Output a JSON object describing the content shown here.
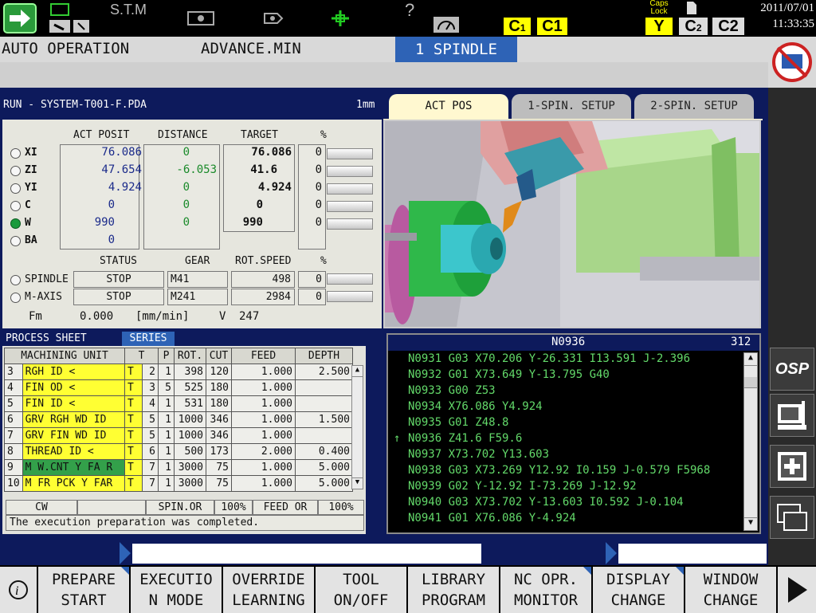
{
  "topbar": {
    "stm": "S.T.M",
    "help": "?",
    "badges": {
      "c1a": "C",
      "c1a_sub": "1",
      "c1": "C1",
      "y": "Y",
      "c2a": "C",
      "c2a_sub": "2",
      "c2": "C2"
    },
    "caps_lock": "Caps Lock",
    "date": "2011/07/01",
    "time": "11:33:35",
    "icons": [
      "mode-arrow-icon",
      "tool-icon",
      "screen-icon",
      "camera-icon",
      "sensor-icon",
      "crosshair-icon",
      "gauge-icon",
      "page-icon"
    ]
  },
  "title": {
    "mode": "AUTO OPERATION",
    "sub": "ADVANCE.MIN",
    "spindle": "1 SPINDLE"
  },
  "run": {
    "label": "RUN - SYSTEM-T001-F.PDA",
    "unit": "1mm"
  },
  "tabs": [
    "ACT POS",
    "1-SPIN. SETUP",
    "2-SPIN. SETUP"
  ],
  "position": {
    "headers": {
      "act": "ACT POSIT",
      "dist": "DISTANCE",
      "target": "TARGET",
      "pct": "%"
    },
    "axes": [
      {
        "name": "XI",
        "act": "76.086",
        "dist": "0",
        "target": "76.086",
        "pct": "0",
        "selected": false
      },
      {
        "name": "ZI",
        "act": "47.654",
        "dist": "-6.053",
        "target": "41.6",
        "pct": "0",
        "selected": false
      },
      {
        "name": "YI",
        "act": "4.924",
        "dist": "0",
        "target": "4.924",
        "pct": "0",
        "selected": false
      },
      {
        "name": "C",
        "act": "0",
        "dist": "0",
        "target": "0",
        "pct": "0",
        "selected": false
      },
      {
        "name": "W",
        "act": "990",
        "dist": "0",
        "target": "990",
        "pct": "0",
        "selected": true
      },
      {
        "name": "BA",
        "act": "0",
        "dist": "",
        "target": "",
        "pct": "",
        "selected": false
      }
    ],
    "spindle_headers": {
      "status": "STATUS",
      "gear": "GEAR",
      "speed": "ROT.SPEED",
      "pct": "%"
    },
    "spindles": [
      {
        "name": "SPINDLE",
        "status": "STOP",
        "gear": "M41",
        "speed": "498",
        "pct": "0"
      },
      {
        "name": "M-AXIS",
        "status": "STOP",
        "gear": "M241",
        "speed": "2984",
        "pct": "0"
      }
    ],
    "fm_label": "Fm",
    "fm_value": "0.000",
    "fm_unit": "[mm/min]",
    "v_label": "V",
    "v_value": "247"
  },
  "process": {
    "title": "PROCESS SHEET",
    "series": "SERIES",
    "columns": [
      "MACHINING UNIT",
      "T",
      "P",
      "ROT.",
      "CUT",
      "FEED",
      "DEPTH"
    ],
    "rows": [
      {
        "no": "3",
        "unit": "RGH ID <",
        "t": "T",
        "tn": "2",
        "p": "1",
        "rot": "398",
        "cut": "120",
        "feed": "1.000",
        "depth": "2.500",
        "color": "y"
      },
      {
        "no": "4",
        "unit": "FIN OD <",
        "t": "T",
        "tn": "3",
        "p": "5",
        "rot": "525",
        "cut": "180",
        "feed": "1.000",
        "depth": "",
        "color": "y"
      },
      {
        "no": "5",
        "unit": "FIN ID <",
        "t": "T",
        "tn": "4",
        "p": "1",
        "rot": "531",
        "cut": "180",
        "feed": "1.000",
        "depth": "",
        "color": "y"
      },
      {
        "no": "6",
        "unit": "GRV RGH WD ID",
        "t": "T",
        "tn": "5",
        "p": "1",
        "rot": "1000",
        "cut": "346",
        "feed": "1.000",
        "depth": "1.500",
        "color": "y"
      },
      {
        "no": "7",
        "unit": "GRV FIN WD ID",
        "t": "T",
        "tn": "5",
        "p": "1",
        "rot": "1000",
        "cut": "346",
        "feed": "1.000",
        "depth": "",
        "color": "y"
      },
      {
        "no": "8",
        "unit": "THREAD ID <",
        "t": "T",
        "tn": "6",
        "p": "1",
        "rot": "500",
        "cut": "173",
        "feed": "2.000",
        "depth": "0.400",
        "color": "y"
      },
      {
        "no": "9",
        "unit": "M W.CNT Y FA R",
        "t": "T",
        "tn": "7",
        "p": "1",
        "rot": "3000",
        "cut": "75",
        "feed": "1.000",
        "depth": "5.000",
        "color": "g"
      },
      {
        "no": "10",
        "unit": "M FR PCK Y FAR",
        "t": "T",
        "tn": "7",
        "p": "1",
        "rot": "3000",
        "cut": "75",
        "feed": "1.000",
        "depth": "5.000",
        "color": "y"
      }
    ],
    "status_cells": [
      "CW",
      "",
      "SPIN.OR",
      "100%",
      "FEED OR",
      "100%"
    ],
    "message": "The execution preparation was completed."
  },
  "program": {
    "block": "N0936",
    "count": "312",
    "current_marker": "↑",
    "lines": [
      "N0931 G03 X70.206 Y-26.331 I13.591 J-2.396",
      "N0932 G01 X73.649 Y-13.795 G40",
      "N0933 G00 Z53",
      "N0934 X76.086 Y4.924",
      "N0935 G01 Z48.8",
      "N0936 Z41.6 F59.6",
      "N0937 X73.702 Y13.603",
      "N0938 G03 X73.269 Y12.92 I0.159 J-0.579 F5968",
      "N0939 G02 Y-12.92 I-73.269 J-12.92",
      "N0940 G03 X73.702 Y-13.603 I0.592 J-0.104",
      "N0941 G01 X76.086 Y-4.924"
    ]
  },
  "side_buttons": {
    "osp": "OSP"
  },
  "function_keys": [
    {
      "l1": "PREPARE",
      "l2": "START"
    },
    {
      "l1": "EXECUTIO",
      "l2": "N MODE"
    },
    {
      "l1": "OVERRIDE",
      "l2": "LEARNING"
    },
    {
      "l1": "TOOL",
      "l2": "ON/OFF"
    },
    {
      "l1": "LIBRARY",
      "l2": "PROGRAM"
    },
    {
      "l1": "NC OPR.",
      "l2": "MONITOR"
    },
    {
      "l1": "DISPLAY",
      "l2": "CHANGE"
    },
    {
      "l1": "WINDOW",
      "l2": "CHANGE"
    }
  ],
  "colors": {
    "accent": "#2e63b6",
    "navy": "#0d1a5c",
    "highlight": "#ffff33",
    "active_row": "#33a04a",
    "code": "#63d96a"
  }
}
